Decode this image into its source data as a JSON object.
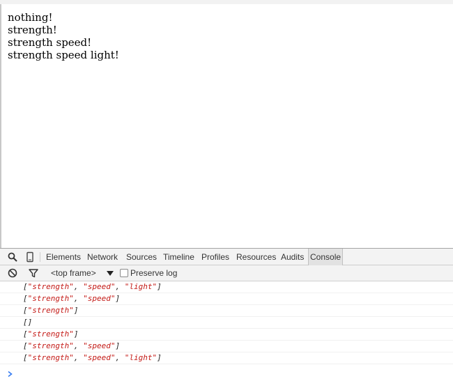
{
  "page": {
    "lines": [
      "nothing!",
      "strength!",
      "strength speed!",
      "strength speed light!"
    ]
  },
  "devtools": {
    "tabs": [
      "Elements",
      "Network",
      "Sources",
      "Timeline",
      "Profiles",
      "Resources",
      "Audits",
      "Console"
    ],
    "active_tab": "Console",
    "frame_selector": "<top frame>",
    "preserve_log_label": "Preserve log",
    "preserve_log_checked": false
  },
  "console": {
    "entries": [
      [
        "strength",
        "speed",
        "light"
      ],
      [
        "strength",
        "speed"
      ],
      [
        "strength"
      ],
      [],
      [
        "strength"
      ],
      [
        "strength",
        "speed"
      ],
      [
        "strength",
        "speed",
        "light"
      ]
    ]
  },
  "colors": {
    "string_value": "#c41a16",
    "prompt_arrow": "#367cf1"
  },
  "icons": [
    "search-icon",
    "device-mode-icon",
    "clear-console-icon",
    "filter-icon",
    "dropdown-arrow-icon",
    "prompt-chevron-icon"
  ]
}
